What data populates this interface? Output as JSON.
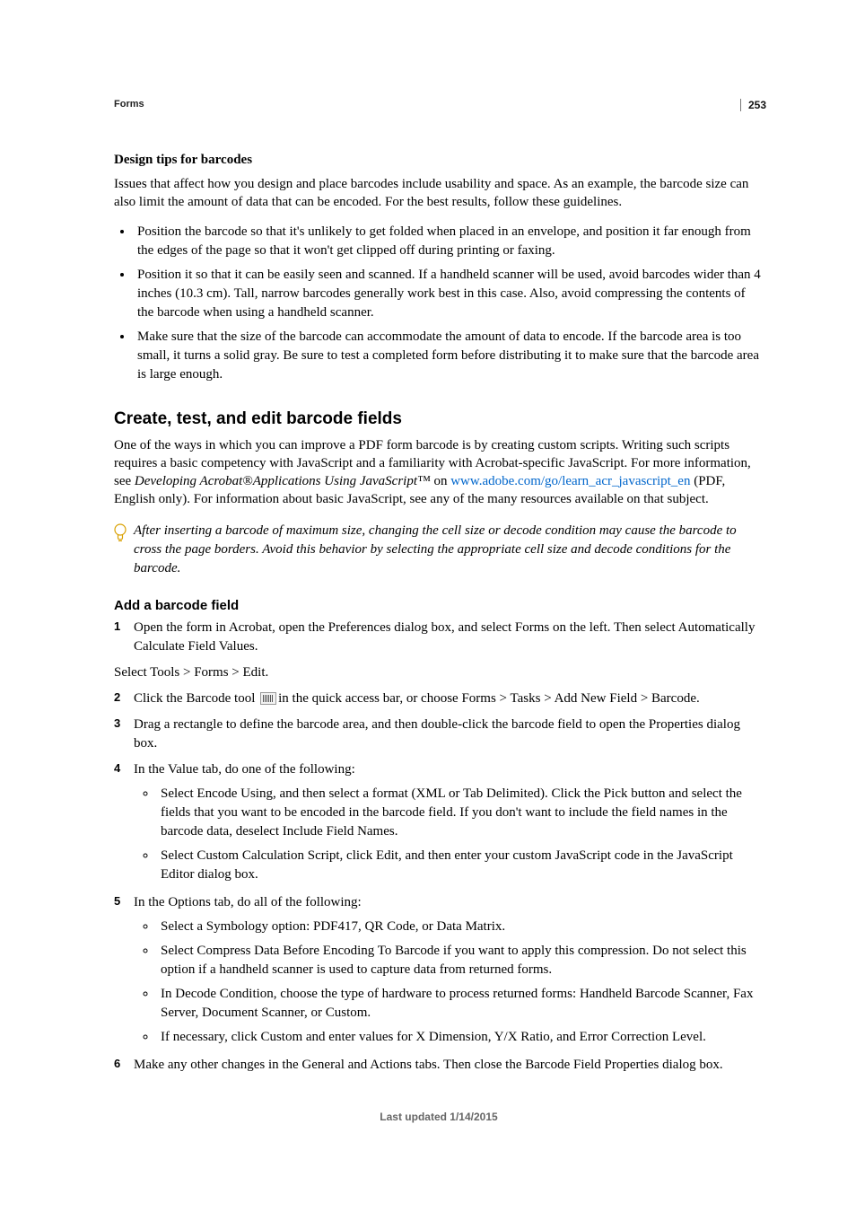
{
  "page_number": "253",
  "breadcrumb": "Forms",
  "h_design_tips": "Design tips for barcodes",
  "p_design_intro": "Issues that affect how you design and place barcodes include usability and space. As an example, the barcode size can also limit the amount of data that can be encoded. For the best results, follow these guidelines.",
  "bullets_design": [
    "Position the barcode so that it's unlikely to get folded when placed in an envelope, and position it far enough from the edges of the page so that it won't get clipped off during printing or faxing.",
    "Position it so that it can be easily seen and scanned. If a handheld scanner will be used, avoid barcodes wider than 4 inches (10.3 cm). Tall, narrow barcodes generally work best in this case. Also, avoid compressing the contents of the barcode when using a handheld scanner.",
    "Make sure that the size of the barcode can accommodate the amount of data to encode. If the barcode area is too small, it turns a solid gray. Be sure to test a completed form before distributing it to make sure that the barcode area is large enough."
  ],
  "h_create": "Create, test, and edit barcode fields",
  "p_create_1a": "One of the ways in which you can improve a PDF form barcode is by creating custom scripts. Writing such scripts requires a basic competency with JavaScript and a familiarity with Acrobat-specific JavaScript. For more information, see ",
  "p_create_1_ital": "Developing Acrobat®Applications Using JavaScript™",
  "p_create_1b": " on ",
  "p_create_1_link": "www.adobe.com/go/learn_acr_javascript_en",
  "p_create_1c": " (PDF, English only). For information about basic JavaScript, see any of the many resources available on that subject.",
  "tip_text": "After inserting a barcode of maximum size, changing the cell size or decode condition may cause the barcode to cross the page borders. Avoid this behavior by selecting the appropriate cell size and decode conditions for the barcode.",
  "h_add": "Add a barcode field",
  "step1": "Open the form in Acrobat, open the Preferences dialog box, and select Forms on the left. Then select Automatically Calculate Field Values.",
  "step1_after": "Select Tools > Forms > Edit.",
  "step2a": "Click the Barcode tool ",
  "step2b": "in the quick access bar, or choose Forms > Tasks > Add New Field > Barcode.",
  "step3": "Drag a rectangle to define the barcode area, and then double-click the barcode field to open the Properties dialog box.",
  "step4": "In the Value tab, do one of the following:",
  "step4_sub": [
    "Select Encode Using, and then select a format (XML or Tab Delimited). Click the Pick button and select the fields that you want to be encoded in the barcode field. If you don't want to include the field names in the barcode data, deselect Include Field Names.",
    "Select Custom Calculation Script, click Edit, and then enter your custom JavaScript code in the JavaScript Editor dialog box."
  ],
  "step5": "In the Options tab, do all of the following:",
  "step5_sub": [
    "Select a Symbology option: PDF417, QR Code, or Data Matrix.",
    "Select Compress Data Before Encoding To Barcode if you want to apply this compression. Do not select this option if a handheld scanner is used to capture data from returned forms.",
    "In Decode Condition, choose the type of hardware to process returned forms: Handheld Barcode Scanner, Fax Server, Document Scanner, or Custom.",
    "If necessary, click Custom and enter values for X Dimension, Y/X Ratio, and Error Correction Level."
  ],
  "step6": "Make any other changes in the General and Actions tabs. Then close the Barcode Field Properties dialog box.",
  "footer": "Last updated 1/14/2015"
}
